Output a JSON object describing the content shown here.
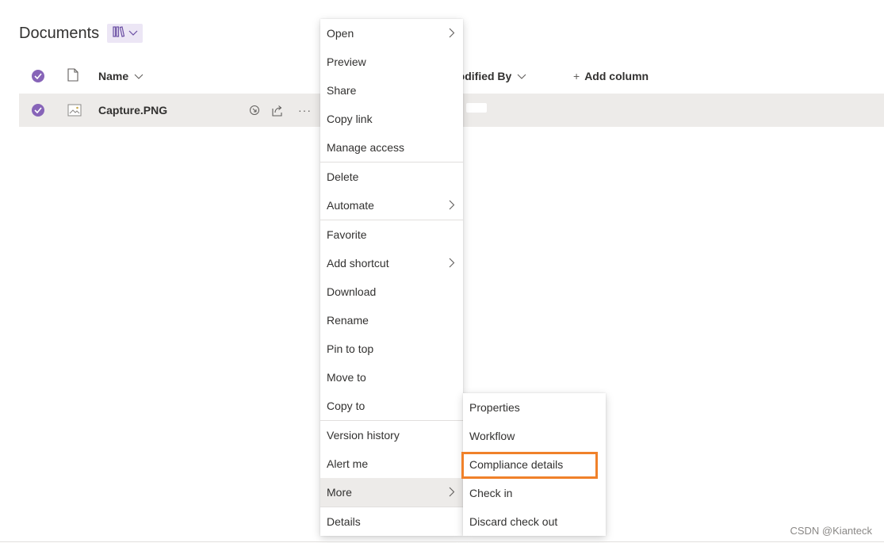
{
  "page": {
    "title": "Documents"
  },
  "columns": {
    "name": "Name",
    "modified_by": "Modified By",
    "add_column": "Add column",
    "add_glyph": "+"
  },
  "file": {
    "name": "Capture.PNG",
    "more_glyph": "···"
  },
  "context_menu": {
    "items": [
      "Open",
      "Preview",
      "Share",
      "Copy link",
      "Manage access",
      "Delete",
      "Automate",
      "Favorite",
      "Add shortcut",
      "Download",
      "Rename",
      "Pin to top",
      "Move to",
      "Copy to",
      "Version history",
      "Alert me",
      "More",
      "Details"
    ]
  },
  "submenu": {
    "items": [
      "Properties",
      "Workflow",
      "Compliance details",
      "Check in",
      "Discard check out"
    ]
  },
  "watermark": "CSDN @Kianteck",
  "colors": {
    "accent": "#8764b8",
    "highlight": "#edebe9",
    "focus_outline": "#f0812a"
  },
  "icons": [
    "view-library-icon",
    "chevron-down-icon",
    "check-circle-icon",
    "file-icon",
    "image-file-icon",
    "checkout-icon",
    "share-icon",
    "more-icon",
    "chevron-right-icon"
  ]
}
